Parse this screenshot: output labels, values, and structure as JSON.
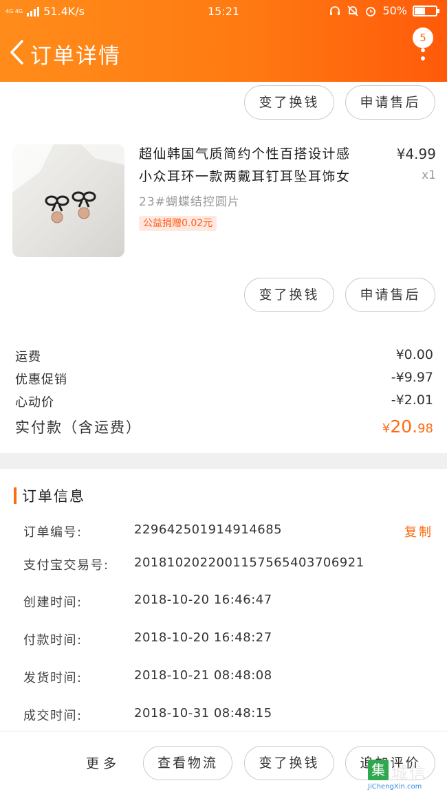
{
  "status_bar": {
    "network": "4G 4G",
    "speed": "51.4K/s",
    "time": "15:21",
    "battery": "50%",
    "battery_level": 0.5
  },
  "header": {
    "title": "订单详情",
    "message_count": "5"
  },
  "top_actions": {
    "exchange_label": "变了换钱",
    "after_sales_label": "申请售后"
  },
  "product": {
    "name_line1": "超仙韩国气质简约个性百搭设计感",
    "name_line2": "小众耳环一款两戴耳钉耳坠耳饰女",
    "price": "¥4.99",
    "quantity": "x1",
    "sku": "23#蝴蝶结控圆片",
    "charity": "公益捐赠0.02元"
  },
  "product_actions": {
    "exchange_label": "变了换钱",
    "after_sales_label": "申请售后"
  },
  "costs": {
    "shipping_label": "运费",
    "shipping_value": "¥0.00",
    "promo_label": "优惠促销",
    "promo_value": "-¥9.97",
    "heart_price_label": "心动价",
    "heart_price_value": "-¥2.01",
    "total_label": "实付款（含运费）",
    "total_currency": "¥",
    "total_integer": "20.",
    "total_decimal": "98"
  },
  "order_info": {
    "title": "订单信息",
    "rows": [
      {
        "label": "订单编号:",
        "value": "229642501914914685"
      },
      {
        "label": "支付宝交易号:",
        "value": "2018102022001157565403706921"
      },
      {
        "label": "创建时间:",
        "value": "2018-10-20 16:46:47"
      },
      {
        "label": "付款时间:",
        "value": "2018-10-20 16:48:27"
      },
      {
        "label": "发货时间:",
        "value": "2018-10-21 08:48:08"
      },
      {
        "label": "成交时间:",
        "value": "2018-10-31 08:48:15"
      }
    ],
    "copy_label": "复制"
  },
  "bottom_bar": {
    "more_label": "更多",
    "logistics_label": "查看物流",
    "exchange_label": "变了换钱",
    "review_label": "追加评价"
  },
  "watermark": {
    "mark": "集",
    "name": "城信",
    "url": "JiChengXin.com"
  },
  "colors": {
    "brand_orange": "#ff7a12",
    "accent": "#ff6a10",
    "charity_bg": "#ffe8e0"
  }
}
